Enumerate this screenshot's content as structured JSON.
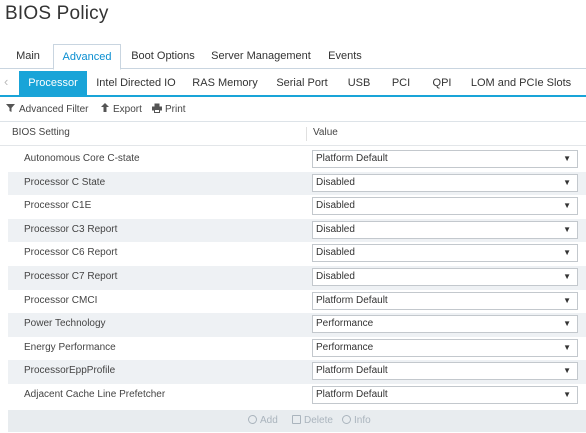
{
  "page": {
    "title": "BIOS Policy"
  },
  "top_tabs": [
    {
      "label": "Main",
      "active": false
    },
    {
      "label": "Advanced",
      "active": true
    },
    {
      "label": "Boot Options",
      "active": false
    },
    {
      "label": "Server Management",
      "active": false
    },
    {
      "label": "Events",
      "active": false
    }
  ],
  "sub_tabs": [
    {
      "label": "Processor",
      "active": true
    },
    {
      "label": "Intel Directed IO",
      "active": false
    },
    {
      "label": "RAS Memory",
      "active": false
    },
    {
      "label": "Serial Port",
      "active": false
    },
    {
      "label": "USB",
      "active": false
    },
    {
      "label": "PCI",
      "active": false
    },
    {
      "label": "QPI",
      "active": false
    },
    {
      "label": "LOM and PCIe Slots",
      "active": false
    }
  ],
  "toolbar": {
    "advanced_filter": "Advanced Filter",
    "export": "Export",
    "print": "Print"
  },
  "table": {
    "headers": {
      "setting": "BIOS Setting",
      "value": "Value"
    },
    "rows": [
      {
        "setting": "Autonomous Core C-state",
        "value": "Platform Default"
      },
      {
        "setting": "Processor C State",
        "value": "Disabled"
      },
      {
        "setting": "Processor C1E",
        "value": "Disabled"
      },
      {
        "setting": "Processor C3 Report",
        "value": "Disabled"
      },
      {
        "setting": "Processor C6 Report",
        "value": "Disabled"
      },
      {
        "setting": "Processor C7 Report",
        "value": "Disabled"
      },
      {
        "setting": "Processor CMCI",
        "value": "Platform Default"
      },
      {
        "setting": "Power Technology",
        "value": "Performance"
      },
      {
        "setting": "Energy Performance",
        "value": "Performance"
      },
      {
        "setting": "ProcessorEppProfile",
        "value": "Platform Default"
      },
      {
        "setting": "Adjacent Cache Line Prefetcher",
        "value": "Platform Default"
      }
    ]
  },
  "bottom_bar": {
    "add": "Add",
    "delete": "Delete",
    "info": "Info"
  },
  "colors": {
    "accent": "#19a4d8",
    "active_tab_text": "#0a8ed1",
    "row_alt": "#eef1f4"
  }
}
